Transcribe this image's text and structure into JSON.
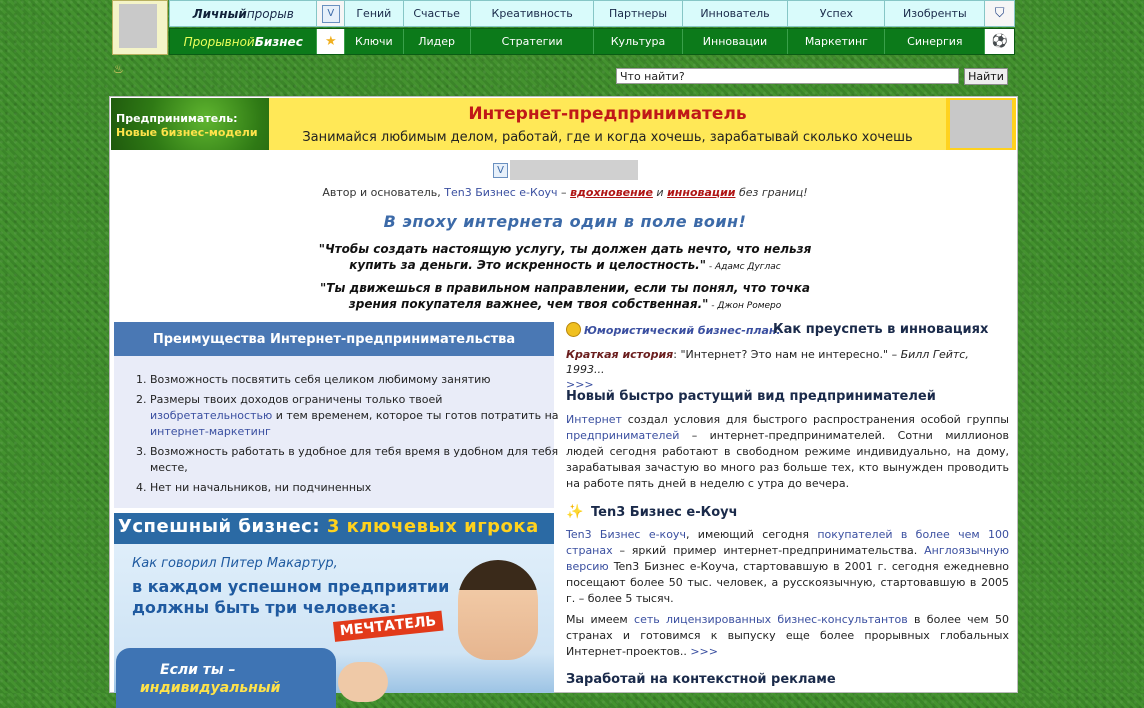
{
  "nav": {
    "row1": {
      "brand_bold": "Личный",
      "brand_rest": " прорыв",
      "items": [
        "Гений",
        "Счастье",
        "Креативность",
        "Партнеры",
        "Иннователь",
        "Успех",
        "Изобренты"
      ]
    },
    "row2": {
      "brand_rest": "Прорывной ",
      "brand_bold": "Бизнес",
      "items": [
        "Ключи",
        "Лидер",
        "Стратегии",
        "Культура",
        "Инновации",
        "Маркетинг",
        "Синергия"
      ]
    },
    "icons": [
      "v-logo-icon",
      "star-icon",
      "badge-icon",
      "soccer-ball-icon"
    ]
  },
  "search": {
    "placeholder": "Что найти?",
    "button": "Найти"
  },
  "banner": {
    "left_line1": "Предприниматель:",
    "left_line2": "Новые бизнес-модели",
    "title": "Интернет-предприниматель",
    "subtitle": "Занимайся любимым делом, работай, где и когда хочешь, зарабатывай сколько хочешь"
  },
  "author": {
    "prefix": "Автор и основатель, ",
    "name": "Теn3 Бизнес е-Коуч",
    "dash": " – ",
    "w1": "вдохновение",
    "and": " и ",
    "w2": "инновации",
    "suffix": " без границ!"
  },
  "slogan": "В эпоху интернета один в поле воин!",
  "quotes": [
    {
      "text": "\"Чтобы создать настоящую услугу, ты должен дать нечто, что нельзя купить за деньги. Это искренность и целостность.\"",
      "author": " - Адамс Дуглас"
    },
    {
      "text": "\"Ты движешься в правильном направлении, если ты понял, что точка зрения покупателя важнее, чем твоя собственная.\"",
      "author": " - Джон Ромеро"
    }
  ],
  "advantages": {
    "title": "Преимущества Интернет-предпринимательства",
    "item1": "Возможность посвятить себя целиком любимому занятию",
    "item2_a": "Размеры твоих доходов ограничены только твоей ",
    "item2_link1": "изобретательностью",
    "item2_b": " и тем временем, которое ты готов потратить на ",
    "item2_link2": "интернет-маркетинг",
    "item3": "Возможность работать в удобное для тебя время в удобном для тебя месте,",
    "item4": "Нет ни начальников, ни подчиненных"
  },
  "promo": {
    "title_a": "Успешный бизнес: ",
    "title_b": "3 ключевых игрока",
    "line1": "Как говорил Питер Макартур,",
    "line2": "в каждом успешном предприятии должны быть три человека:",
    "dreamer": "МЕЧТАТЕЛЬ",
    "blob1": "Если ты –",
    "blob2": "индивидуальный"
  },
  "humor": {
    "label": "Юмористический бизнес-план:",
    "title": "Как преуспеть в инновациях",
    "short_label": "Краткая история",
    "short_text": ": \"Интернет? Это нам не интересно.\" – ",
    "short_author": "Билл Гейтс, 1993...",
    "more": ">>>"
  },
  "new_type": {
    "title": "Новый быстро растущий вид предпринимателей",
    "link1": "Интернет",
    "text1": " создал условия для быстрого распространения особой группы ",
    "link2": "предпринимателей",
    "text2": " – интернет-предпринимателей. Сотни миллионов людей сегодня работают в свободном режиме индивидуально, на дому, зарабатывая зачастую во много раз больше тех, кто вынужден проводить на работе пять дней в неделю с утра до вечера."
  },
  "ten3": {
    "title": "Ten3 Бизнес е-Коуч",
    "link1": "Ten3 Бизнес е-коуч",
    "t1": ", имеющий сегодня ",
    "link2": "покупателей",
    "t2": " ",
    "link3": "в более чем 100 странах",
    "t3": " – яркий пример интернет-предпринимательства. ",
    "link4": "Англоязычную версию",
    "t4": " Ten3 Бизнес е-Коуча, стартовавшую в 2001 г. сегодня ежедневно посещают более 50 тыс. человек, а русскоязычную, стартовавшую в 2005 г. – более 5 тысяч.",
    "p2_a": "Мы имеем ",
    "p2_link": "сеть лицензированных бизнес-консультантов",
    "p2_b": " в более чем 50 странах и готовимся к выпуску еще более прорывных глобальных Интернет-проектов.. ",
    "p2_more": ">>>"
  },
  "context_ad": {
    "title": "Заработай на контекстной рекламе"
  }
}
